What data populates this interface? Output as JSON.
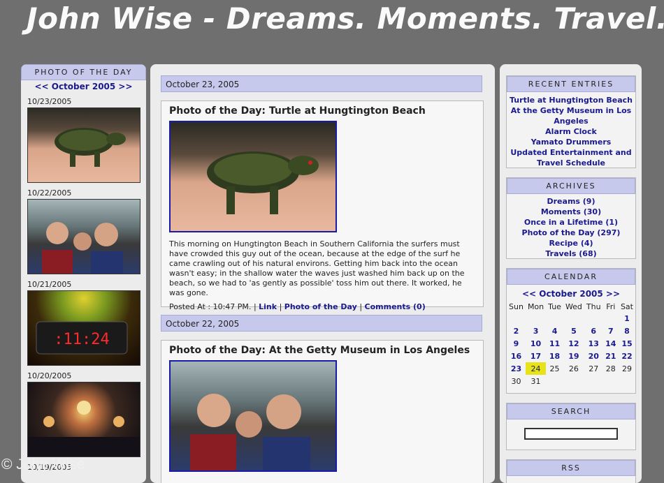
{
  "site": {
    "title": "John Wise - Dreams. Moments. Travel."
  },
  "left": {
    "heading": "PHOTO OF THE DAY",
    "month_nav": "<< October 2005 >>",
    "photos": [
      {
        "date": "10/23/2005",
        "subject": "turtle"
      },
      {
        "date": "10/22/2005",
        "subject": "people"
      },
      {
        "date": "10/21/2005",
        "subject": "alarm-clock"
      },
      {
        "date": "10/20/2005",
        "subject": "stage"
      },
      {
        "date": "10/19/2005",
        "subject": ""
      }
    ]
  },
  "posts": [
    {
      "date": "October 23, 2005",
      "title": "Photo of the Day: Turtle at Hungtington Beach",
      "body": "This morning on Hungtington Beach in Southern California the surfers must have crowded this guy out of the ocean, because at the edge of the surf he came crawling out of his natural environs. Getting him back into the ocean wasn't easy; in the shallow water the waves just washed him back up on the beach, so we had to 'as gently as possible' toss him out there. It worked, he was gone.",
      "posted_at": "Posted At : 10:47 PM.",
      "link_label": "Link",
      "category_label": "Photo of the Day",
      "comments_label": "Comments (0)"
    },
    {
      "date": "October 22, 2005",
      "title": "Photo of the Day: At the Getty Museum in Los Angeles"
    }
  ],
  "right": {
    "recent": {
      "heading": "RECENT ENTRIES",
      "items": [
        "Turtle at Hungtington Beach",
        "At the Getty Museum in Los Angeles",
        "Alarm Clock",
        "Yamato Drummers",
        "Updated Entertainment and Travel Schedule"
      ]
    },
    "archives": {
      "heading": "ARCHIVES",
      "items": [
        "Dreams (9)",
        "Moments (30)",
        "Once in a Lifetime (1)",
        "Photo of the Day (297)",
        "Recipe (4)",
        "Travels (68)"
      ]
    },
    "calendar": {
      "heading": "CALENDAR",
      "month_nav": "<< October 2005 >>",
      "days_of_week": [
        "Sun",
        "Mon",
        "Tue",
        "Wed",
        "Thu",
        "Fri",
        "Sat"
      ],
      "weeks": [
        [
          "",
          "",
          "",
          "",
          "",
          "",
          "1"
        ],
        [
          "2",
          "3",
          "4",
          "5",
          "6",
          "7",
          "8"
        ],
        [
          "9",
          "10",
          "11",
          "12",
          "13",
          "14",
          "15"
        ],
        [
          "16",
          "17",
          "18",
          "19",
          "20",
          "21",
          "22"
        ],
        [
          "23",
          "24",
          "25",
          "26",
          "27",
          "28",
          "29"
        ],
        [
          "30",
          "31",
          "",
          "",
          "",
          "",
          ""
        ]
      ],
      "today": "24",
      "linked_max": 23
    },
    "search": {
      "heading": "SEARCH",
      "placeholder": ""
    },
    "rss": {
      "heading": "RSS"
    }
  },
  "watermark": "© John Wise",
  "colors": {
    "background": "#6f6f6f",
    "panel": "#ececec",
    "header_band": "#c7c9ec",
    "link": "#1a1a8e",
    "image_border": "#1a1aa8",
    "calendar_today": "#e8e21a"
  }
}
